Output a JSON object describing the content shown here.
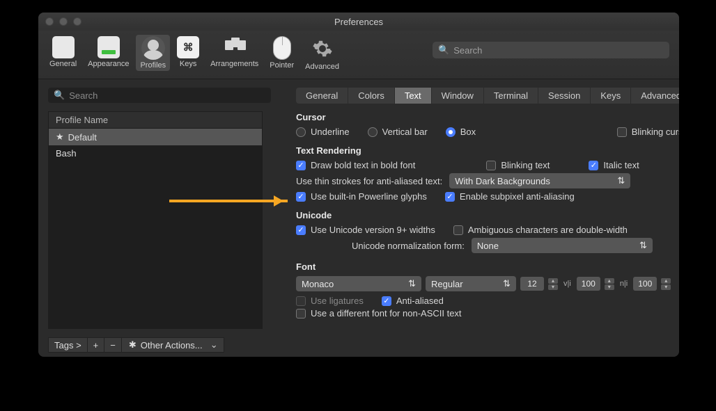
{
  "window": {
    "title": "Preferences"
  },
  "toolbar": {
    "items": [
      {
        "name": "general",
        "label": "General"
      },
      {
        "name": "appearance",
        "label": "Appearance"
      },
      {
        "name": "profiles",
        "label": "Profiles"
      },
      {
        "name": "keys",
        "label": "Keys",
        "glyph": "⌘"
      },
      {
        "name": "arrangements",
        "label": "Arrangements"
      },
      {
        "name": "pointer",
        "label": "Pointer"
      },
      {
        "name": "advanced",
        "label": "Advanced"
      }
    ],
    "selected": "profiles",
    "search_placeholder": "Search"
  },
  "sidebar": {
    "search_placeholder": "Search",
    "header": "Profile Name",
    "rows": [
      {
        "label": "Default",
        "starred": true,
        "selected": true
      },
      {
        "label": "Bash",
        "starred": false,
        "selected": false
      }
    ],
    "footer": {
      "tags_label": "Tags >",
      "plus": "+",
      "minus": "−",
      "other_actions": "Other Actions..."
    }
  },
  "tabs": {
    "items": [
      "General",
      "Colors",
      "Text",
      "Window",
      "Terminal",
      "Session",
      "Keys",
      "Advanced"
    ],
    "selected": "Text"
  },
  "cursor": {
    "heading": "Cursor",
    "options": [
      "Underline",
      "Vertical bar",
      "Box"
    ],
    "selected": "Box",
    "blinking_label": "Blinking cursor",
    "blinking": false
  },
  "rendering": {
    "heading": "Text Rendering",
    "bold_label": "Draw bold text in bold font",
    "bold": true,
    "blinking_label": "Blinking text",
    "blinking": false,
    "italic_label": "Italic text",
    "italic": true,
    "thin_label": "Use thin strokes for anti-aliased text:",
    "thin_value": "With Dark Backgrounds",
    "powerline_label": "Use built-in Powerline glyphs",
    "powerline": true,
    "subpixel_label": "Enable subpixel anti-aliasing",
    "subpixel": true
  },
  "unicode": {
    "heading": "Unicode",
    "v9_label": "Use Unicode version 9+ widths",
    "v9": true,
    "ambiguous_label": "Ambiguous characters are double-width",
    "ambiguous": false,
    "norm_label": "Unicode normalization form:",
    "norm_value": "None"
  },
  "font": {
    "heading": "Font",
    "family": "Monaco",
    "style": "Regular",
    "size": "12",
    "vli": "100",
    "nli": "100",
    "ligatures_label": "Use ligatures",
    "ligatures": false,
    "aa_label": "Anti-aliased",
    "aa": true,
    "non_ascii_label": "Use a different font for non-ASCII text",
    "non_ascii": false
  }
}
